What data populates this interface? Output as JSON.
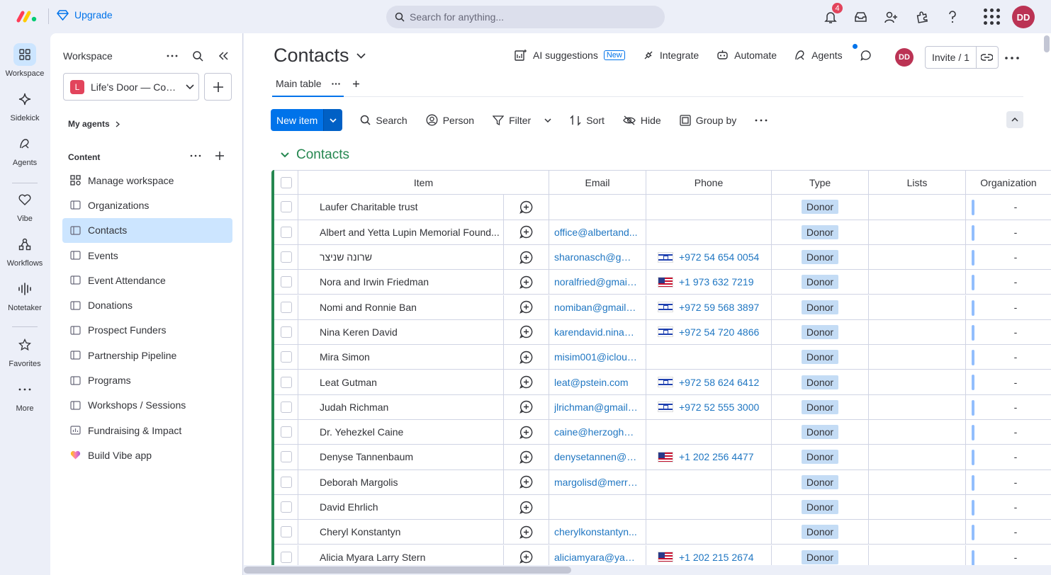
{
  "topbar": {
    "upgrade_label": "Upgrade",
    "search_placeholder": "Search for anything...",
    "notification_count": "4",
    "avatar_initials": "DD"
  },
  "rail": {
    "items": [
      {
        "label": "Workspace",
        "icon": "workspace-grid-icon"
      },
      {
        "label": "Sidekick",
        "icon": "sparkle-icon"
      },
      {
        "label": "Agents",
        "icon": "agents-icon"
      },
      {
        "label": "Vibe",
        "icon": "heart-icon"
      },
      {
        "label": "Workflows",
        "icon": "workflows-icon"
      },
      {
        "label": "Notetaker",
        "icon": "waveform-icon"
      },
      {
        "label": "Favorites",
        "icon": "star-icon"
      },
      {
        "label": "More",
        "icon": "more-dots-icon"
      }
    ]
  },
  "workspace": {
    "header": "Workspace",
    "selected_name": "Life's Door — Con...",
    "selected_badge": "L",
    "my_agents": "My agents",
    "content_label": "Content",
    "nav": [
      {
        "label": "Manage workspace",
        "icon": "manage-icon"
      },
      {
        "label": "Organizations",
        "icon": "board-icon"
      },
      {
        "label": "Contacts",
        "icon": "board-icon"
      },
      {
        "label": "Events",
        "icon": "board-icon"
      },
      {
        "label": "Event Attendance",
        "icon": "board-icon"
      },
      {
        "label": "Donations",
        "icon": "board-icon"
      },
      {
        "label": "Prospect Funders",
        "icon": "board-icon"
      },
      {
        "label": "Partnership Pipeline",
        "icon": "board-icon"
      },
      {
        "label": "Programs",
        "icon": "board-icon"
      },
      {
        "label": "Workshops / Sessions",
        "icon": "board-icon"
      },
      {
        "label": "Fundraising & Impact",
        "icon": "dashboard-icon"
      },
      {
        "label": "Build Vibe app",
        "icon": "vibe-heart-icon"
      }
    ]
  },
  "board": {
    "title": "Contacts",
    "ai_suggestions": "AI suggestions",
    "new_tag": "New",
    "integrate": "Integrate",
    "automate": "Automate",
    "agents": "Agents",
    "avatar_initials": "DD",
    "invite": "Invite / 1",
    "tab_main": "Main table",
    "toolbar": {
      "new_item": "New item",
      "search": "Search",
      "person": "Person",
      "filter": "Filter",
      "sort": "Sort",
      "hide": "Hide",
      "group_by": "Group by"
    },
    "group_title": "Contacts",
    "columns": {
      "item": "Item",
      "email": "Email",
      "phone": "Phone",
      "type": "Type",
      "lists": "Lists",
      "organization": "Organization"
    },
    "rows": [
      {
        "item": "Laufer Charitable trust",
        "email": "",
        "phone": "",
        "flag": "",
        "type": "Donor",
        "org": "-"
      },
      {
        "item": "Albert and Yetta Lupin Memorial Found...",
        "email": "office@albertand...",
        "phone": "",
        "flag": "",
        "type": "Donor",
        "org": "-"
      },
      {
        "item": "שרונה שניצר",
        "email": "sharonasch@gma...",
        "phone": "+972 54 654 0054",
        "flag": "il",
        "type": "Donor",
        "org": "-"
      },
      {
        "item": "Nora and Irwin Friedman",
        "email": "noralfried@gmail....",
        "phone": "+1 973 632 7219",
        "flag": "us",
        "type": "Donor",
        "org": "-"
      },
      {
        "item": "Nomi and Ronnie Ban",
        "email": "nomiban@gmail.c...",
        "phone": "+972 59 568 3897",
        "flag": "il",
        "type": "Donor",
        "org": "-"
      },
      {
        "item": "Nina Keren David",
        "email": "karendavid.nina@...",
        "phone": "+972 54 720 4866",
        "flag": "il",
        "type": "Donor",
        "org": "-"
      },
      {
        "item": "Mira Simon",
        "email": "misim001@icloud....",
        "phone": "",
        "flag": "",
        "type": "Donor",
        "org": "-"
      },
      {
        "item": "Leat Gutman",
        "email": "leat@pstein.com",
        "phone": "+972 58 624 6412",
        "flag": "il",
        "type": "Donor",
        "org": "-"
      },
      {
        "item": "Judah Richman",
        "email": "jlrichman@gmail....",
        "phone": "+972 52 555 3000",
        "flag": "il",
        "type": "Donor",
        "org": "-"
      },
      {
        "item": "Dr. Yehezkel Caine",
        "email": "caine@herzoghos...",
        "phone": "",
        "flag": "",
        "type": "Donor",
        "org": "-"
      },
      {
        "item": "Denyse Tannenbaum",
        "email": "denysetannen@g...",
        "phone": "+1 202 256 4477",
        "flag": "us",
        "type": "Donor",
        "org": "-"
      },
      {
        "item": "Deborah Margolis",
        "email": "margolisd@merri...",
        "phone": "",
        "flag": "",
        "type": "Donor",
        "org": "-"
      },
      {
        "item": "David Ehrlich",
        "email": "",
        "phone": "",
        "flag": "",
        "type": "Donor",
        "org": "-"
      },
      {
        "item": "Cheryl Konstantyn",
        "email": "cherylkonstantyn...",
        "phone": "",
        "flag": "",
        "type": "Donor",
        "org": "-"
      },
      {
        "item": "Alicia Myara Larry Stern",
        "email": "aliciamyara@yaho...",
        "phone": "+1 202 215 2674",
        "flag": "us",
        "type": "Donor",
        "org": "-"
      }
    ]
  },
  "colors": {
    "accent": "#0073ea",
    "group": "#258750",
    "type_badge": "#c4dcf5",
    "avatar": "#bb3354"
  }
}
